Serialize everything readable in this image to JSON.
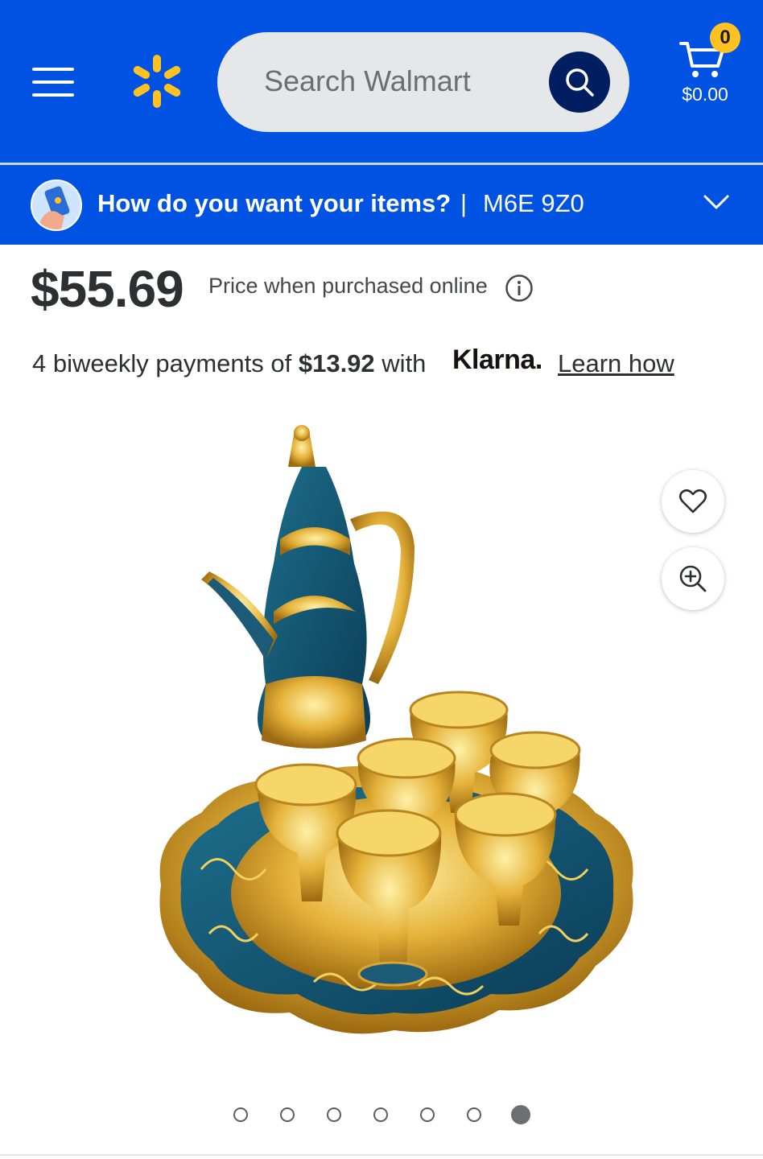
{
  "header": {
    "search": {
      "placeholder": "Search Walmart"
    },
    "cart": {
      "count": "0",
      "total": "$0.00"
    }
  },
  "delivery": {
    "question": "How do you want your items?",
    "separator": "|",
    "postal_code": "M6E 9Z0"
  },
  "product": {
    "price": "$55.69",
    "price_note": "Price when purchased online",
    "installments": {
      "prefix": "4 biweekly payments of",
      "amount": "$13.92",
      "suffix": "with",
      "provider": "Klarna.",
      "learn_link": "Learn how"
    },
    "image_count": 7,
    "active_image": 7
  },
  "colors": {
    "brand_blue": "#0053e2",
    "spark_yellow": "#ffc220",
    "search_button": "#001e60"
  }
}
